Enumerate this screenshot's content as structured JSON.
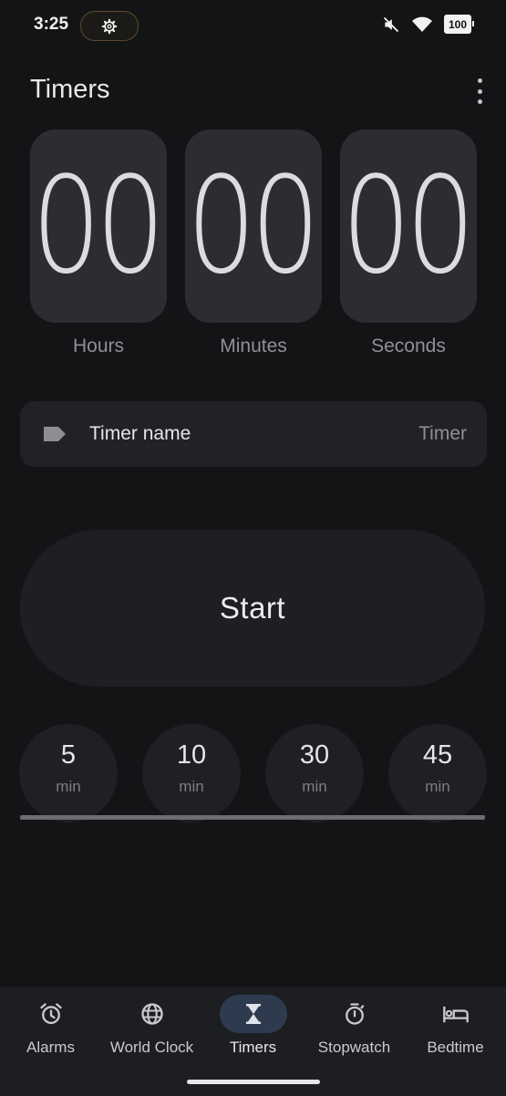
{
  "status_bar": {
    "time": "3:25",
    "battery": "100",
    "icons": [
      "settings-icon",
      "mute-icon",
      "wifi-icon",
      "battery-icon"
    ]
  },
  "header": {
    "title": "Timers",
    "menu_icon": "more-vert-icon"
  },
  "time_inputs": [
    {
      "value": "00",
      "label": "Hours"
    },
    {
      "value": "00",
      "label": "Minutes"
    },
    {
      "value": "00",
      "label": "Seconds"
    }
  ],
  "timer_name": {
    "icon": "label-icon",
    "label": "Timer name",
    "value": "Timer"
  },
  "start_button": {
    "label": "Start"
  },
  "presets": [
    {
      "value": "5",
      "unit": "min"
    },
    {
      "value": "10",
      "unit": "min"
    },
    {
      "value": "30",
      "unit": "min"
    },
    {
      "value": "45",
      "unit": "min"
    }
  ],
  "bottom_nav": {
    "active": "Timers",
    "items": [
      {
        "label": "Alarms",
        "icon": "alarm-icon"
      },
      {
        "label": "World Clock",
        "icon": "globe-icon"
      },
      {
        "label": "Timers",
        "icon": "hourglass-icon"
      },
      {
        "label": "Stopwatch",
        "icon": "stopwatch-icon"
      },
      {
        "label": "Bedtime",
        "icon": "bed-icon"
      }
    ]
  },
  "colors": {
    "background": "#131416",
    "surface": "#2c2d31",
    "accent_pill": "#2e3b4e"
  }
}
